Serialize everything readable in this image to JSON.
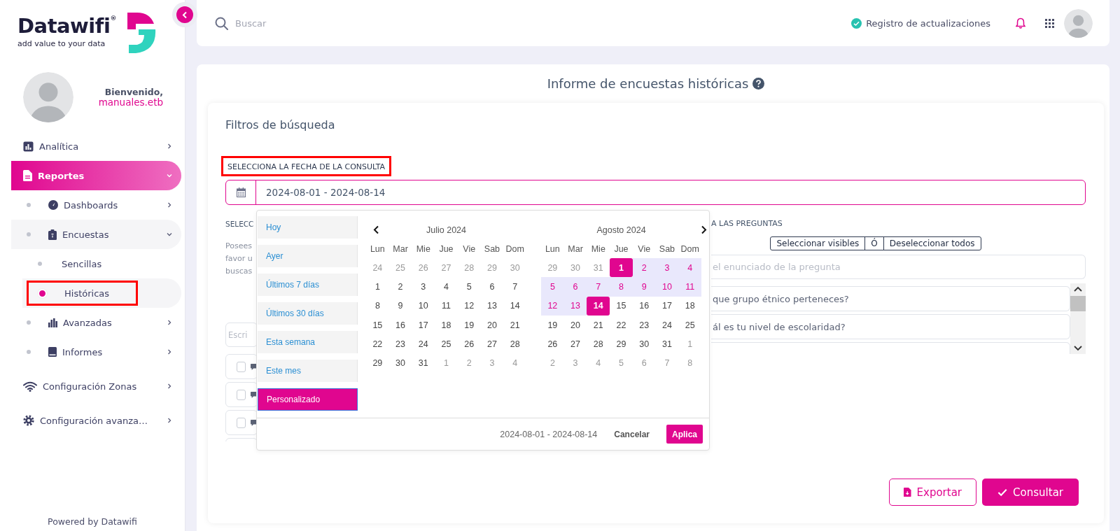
{
  "sidebar": {
    "logo": {
      "name": "Datawifi$^{®}$",
      "tagline": "add value to your data"
    },
    "user": {
      "greeting": "Bienvenido,",
      "username": "manuales.etb"
    },
    "nav": [
      {
        "label": "Analítica",
        "expanded": false,
        "selected": false
      },
      {
        "label": "Reportes",
        "expanded": true,
        "selected": true,
        "children": [
          {
            "label": "Dashboards",
            "expanded": false
          },
          {
            "label": "Encuestas",
            "expanded": true,
            "children": [
              {
                "label": "Sencillas",
                "selected": false,
                "annotated": false
              },
              {
                "label": "Históricas",
                "selected": true,
                "annotated": true
              }
            ]
          },
          {
            "label": "Avanzadas",
            "expanded": false
          },
          {
            "label": "Informes",
            "expanded": false
          }
        ]
      },
      {
        "label": "Configuración Zonas",
        "expanded": false,
        "selected": false
      },
      {
        "label": "Configuración avanza…",
        "expanded": false,
        "selected": false
      }
    ],
    "footer": "Powered by Datawifi"
  },
  "topbar": {
    "search_placeholder": "Buscar",
    "updates_link": "Registro de actualizaciones"
  },
  "report": {
    "title": "Informe de encuestas históricas",
    "filters_title": "Filtros de búsqueda",
    "date": {
      "label": "SELECCIONA LA FECHA DE LA CONSULTA",
      "annotated": true,
      "value": "2024-08-01 - 2024-08-14"
    },
    "left": {
      "heading": "SELECC",
      "lines": [
        "Posees",
        "favor u",
        "buscas"
      ],
      "search_placeholder": "Escri",
      "rows": [
        {
          "checked": false
        },
        {
          "checked": false
        },
        {
          "checked": false
        }
      ]
    },
    "right": {
      "heading": "A LAS PREGUNTAS",
      "actions": [
        "Seleccionar visibles",
        "Ó",
        "Deseleccionar todos"
      ],
      "search_placeholder": "el enunciado de la pregunta",
      "questions": [
        "que grupo étnico perteneces?",
        "ál es tu nivel de escolaridad?"
      ]
    },
    "picker": {
      "ranges": [
        {
          "label": "Hoy",
          "selected": false
        },
        {
          "label": "Ayer",
          "selected": false
        },
        {
          "label": "Últimos 7 días",
          "selected": false
        },
        {
          "label": "Últimos 30 días",
          "selected": false
        },
        {
          "label": "Esta semana",
          "selected": false
        },
        {
          "label": "Este mes",
          "selected": false
        },
        {
          "label": "Personalizado",
          "selected": true
        }
      ],
      "months": [
        {
          "title": "Julio 2024",
          "weekdays": [
            "Lun",
            "Mar",
            "Mie",
            "Jue",
            "Vie",
            "Sab",
            "Dom"
          ],
          "weeks": [
            [
              {
                "day": "24",
                "outside": true,
                "in_range": false,
                "selected": false
              },
              {
                "day": "25",
                "outside": true,
                "in_range": false,
                "selected": false
              },
              {
                "day": "26",
                "outside": true,
                "in_range": false,
                "selected": false
              },
              {
                "day": "27",
                "outside": true,
                "in_range": false,
                "selected": false
              },
              {
                "day": "28",
                "outside": true,
                "in_range": false,
                "selected": false
              },
              {
                "day": "29",
                "outside": true,
                "in_range": false,
                "selected": false
              },
              {
                "day": "30",
                "outside": true,
                "in_range": false,
                "selected": false
              }
            ],
            [
              {
                "day": "1",
                "outside": false,
                "in_range": false,
                "selected": false
              },
              {
                "day": "2",
                "outside": false,
                "in_range": false,
                "selected": false
              },
              {
                "day": "3",
                "outside": false,
                "in_range": false,
                "selected": false
              },
              {
                "day": "4",
                "outside": false,
                "in_range": false,
                "selected": false
              },
              {
                "day": "5",
                "outside": false,
                "in_range": false,
                "selected": false
              },
              {
                "day": "6",
                "outside": false,
                "in_range": false,
                "selected": false
              },
              {
                "day": "7",
                "outside": false,
                "in_range": false,
                "selected": false
              }
            ],
            [
              {
                "day": "8",
                "outside": false,
                "in_range": false,
                "selected": false
              },
              {
                "day": "9",
                "outside": false,
                "in_range": false,
                "selected": false
              },
              {
                "day": "10",
                "outside": false,
                "in_range": false,
                "selected": false
              },
              {
                "day": "11",
                "outside": false,
                "in_range": false,
                "selected": false
              },
              {
                "day": "12",
                "outside": false,
                "in_range": false,
                "selected": false
              },
              {
                "day": "13",
                "outside": false,
                "in_range": false,
                "selected": false
              },
              {
                "day": "14",
                "outside": false,
                "in_range": false,
                "selected": false
              }
            ],
            [
              {
                "day": "15",
                "outside": false,
                "in_range": false,
                "selected": false
              },
              {
                "day": "16",
                "outside": false,
                "in_range": false,
                "selected": false
              },
              {
                "day": "17",
                "outside": false,
                "in_range": false,
                "selected": false
              },
              {
                "day": "18",
                "outside": false,
                "in_range": false,
                "selected": false
              },
              {
                "day": "19",
                "outside": false,
                "in_range": false,
                "selected": false
              },
              {
                "day": "20",
                "outside": false,
                "in_range": false,
                "selected": false
              },
              {
                "day": "21",
                "outside": false,
                "in_range": false,
                "selected": false
              }
            ],
            [
              {
                "day": "22",
                "outside": false,
                "in_range": false,
                "selected": false
              },
              {
                "day": "23",
                "outside": false,
                "in_range": false,
                "selected": false
              },
              {
                "day": "24",
                "outside": false,
                "in_range": false,
                "selected": false
              },
              {
                "day": "25",
                "outside": false,
                "in_range": false,
                "selected": false
              },
              {
                "day": "26",
                "outside": false,
                "in_range": false,
                "selected": false
              },
              {
                "day": "27",
                "outside": false,
                "in_range": false,
                "selected": false
              },
              {
                "day": "28",
                "outside": false,
                "in_range": false,
                "selected": false
              }
            ],
            [
              {
                "day": "29",
                "outside": false,
                "in_range": false,
                "selected": false
              },
              {
                "day": "30",
                "outside": false,
                "in_range": false,
                "selected": false
              },
              {
                "day": "31",
                "outside": false,
                "in_range": false,
                "selected": false
              },
              {
                "day": "1",
                "outside": true,
                "in_range": false,
                "selected": false
              },
              {
                "day": "2",
                "outside": true,
                "in_range": false,
                "selected": false
              },
              {
                "day": "3",
                "outside": true,
                "in_range": false,
                "selected": false
              },
              {
                "day": "4",
                "outside": true,
                "in_range": false,
                "selected": false
              }
            ]
          ]
        },
        {
          "title": "Agosto 2024",
          "weekdays": [
            "Lun",
            "Mar",
            "Mie",
            "Jue",
            "Vie",
            "Sab",
            "Dom"
          ],
          "weeks": [
            [
              {
                "day": "29",
                "outside": true,
                "in_range": false,
                "selected": false
              },
              {
                "day": "30",
                "outside": true,
                "in_range": false,
                "selected": false
              },
              {
                "day": "31",
                "outside": true,
                "in_range": false,
                "selected": false
              },
              {
                "day": "1",
                "outside": false,
                "in_range": true,
                "selected": true
              },
              {
                "day": "2",
                "outside": false,
                "in_range": true,
                "selected": false
              },
              {
                "day": "3",
                "outside": false,
                "in_range": true,
                "selected": false
              },
              {
                "day": "4",
                "outside": false,
                "in_range": true,
                "selected": false
              }
            ],
            [
              {
                "day": "5",
                "outside": false,
                "in_range": true,
                "selected": false
              },
              {
                "day": "6",
                "outside": false,
                "in_range": true,
                "selected": false
              },
              {
                "day": "7",
                "outside": false,
                "in_range": true,
                "selected": false
              },
              {
                "day": "8",
                "outside": false,
                "in_range": true,
                "selected": false
              },
              {
                "day": "9",
                "outside": false,
                "in_range": true,
                "selected": false
              },
              {
                "day": "10",
                "outside": false,
                "in_range": true,
                "selected": false
              },
              {
                "day": "11",
                "outside": false,
                "in_range": true,
                "selected": false
              }
            ],
            [
              {
                "day": "12",
                "outside": false,
                "in_range": true,
                "selected": false
              },
              {
                "day": "13",
                "outside": false,
                "in_range": true,
                "selected": false
              },
              {
                "day": "14",
                "outside": false,
                "in_range": true,
                "selected": true
              },
              {
                "day": "15",
                "outside": false,
                "in_range": false,
                "selected": false
              },
              {
                "day": "16",
                "outside": false,
                "in_range": false,
                "selected": false
              },
              {
                "day": "17",
                "outside": false,
                "in_range": false,
                "selected": false
              },
              {
                "day": "18",
                "outside": false,
                "in_range": false,
                "selected": false
              }
            ],
            [
              {
                "day": "19",
                "outside": false,
                "in_range": false,
                "selected": false
              },
              {
                "day": "20",
                "outside": false,
                "in_range": false,
                "selected": false
              },
              {
                "day": "21",
                "outside": false,
                "in_range": false,
                "selected": false
              },
              {
                "day": "22",
                "outside": false,
                "in_range": false,
                "selected": false
              },
              {
                "day": "23",
                "outside": false,
                "in_range": false,
                "selected": false
              },
              {
                "day": "24",
                "outside": false,
                "in_range": false,
                "selected": false
              },
              {
                "day": "25",
                "outside": false,
                "in_range": false,
                "selected": false
              }
            ],
            [
              {
                "day": "26",
                "outside": false,
                "in_range": false,
                "selected": false
              },
              {
                "day": "27",
                "outside": false,
                "in_range": false,
                "selected": false
              },
              {
                "day": "28",
                "outside": false,
                "in_range": false,
                "selected": false
              },
              {
                "day": "29",
                "outside": false,
                "in_range": false,
                "selected": false
              },
              {
                "day": "30",
                "outside": false,
                "in_range": false,
                "selected": false
              },
              {
                "day": "31",
                "outside": false,
                "in_range": false,
                "selected": false
              },
              {
                "day": "1",
                "outside": true,
                "in_range": false,
                "selected": false
              }
            ],
            [
              {
                "day": "2",
                "outside": true,
                "in_range": false,
                "selected": false
              },
              {
                "day": "3",
                "outside": true,
                "in_range": false,
                "selected": false
              },
              {
                "day": "4",
                "outside": true,
                "in_range": false,
                "selected": false
              },
              {
                "day": "5",
                "outside": true,
                "in_range": false,
                "selected": false
              },
              {
                "day": "6",
                "outside": true,
                "in_range": false,
                "selected": false
              },
              {
                "day": "7",
                "outside": true,
                "in_range": false,
                "selected": false
              },
              {
                "day": "8",
                "outside": true,
                "in_range": false,
                "selected": false
              }
            ]
          ]
        }
      ],
      "footer_range": "2024-08-01 - 2024-08-14",
      "cancel": "Cancelar",
      "apply": "Aplica"
    },
    "export": "Exportar",
    "submit": "Consultar"
  }
}
